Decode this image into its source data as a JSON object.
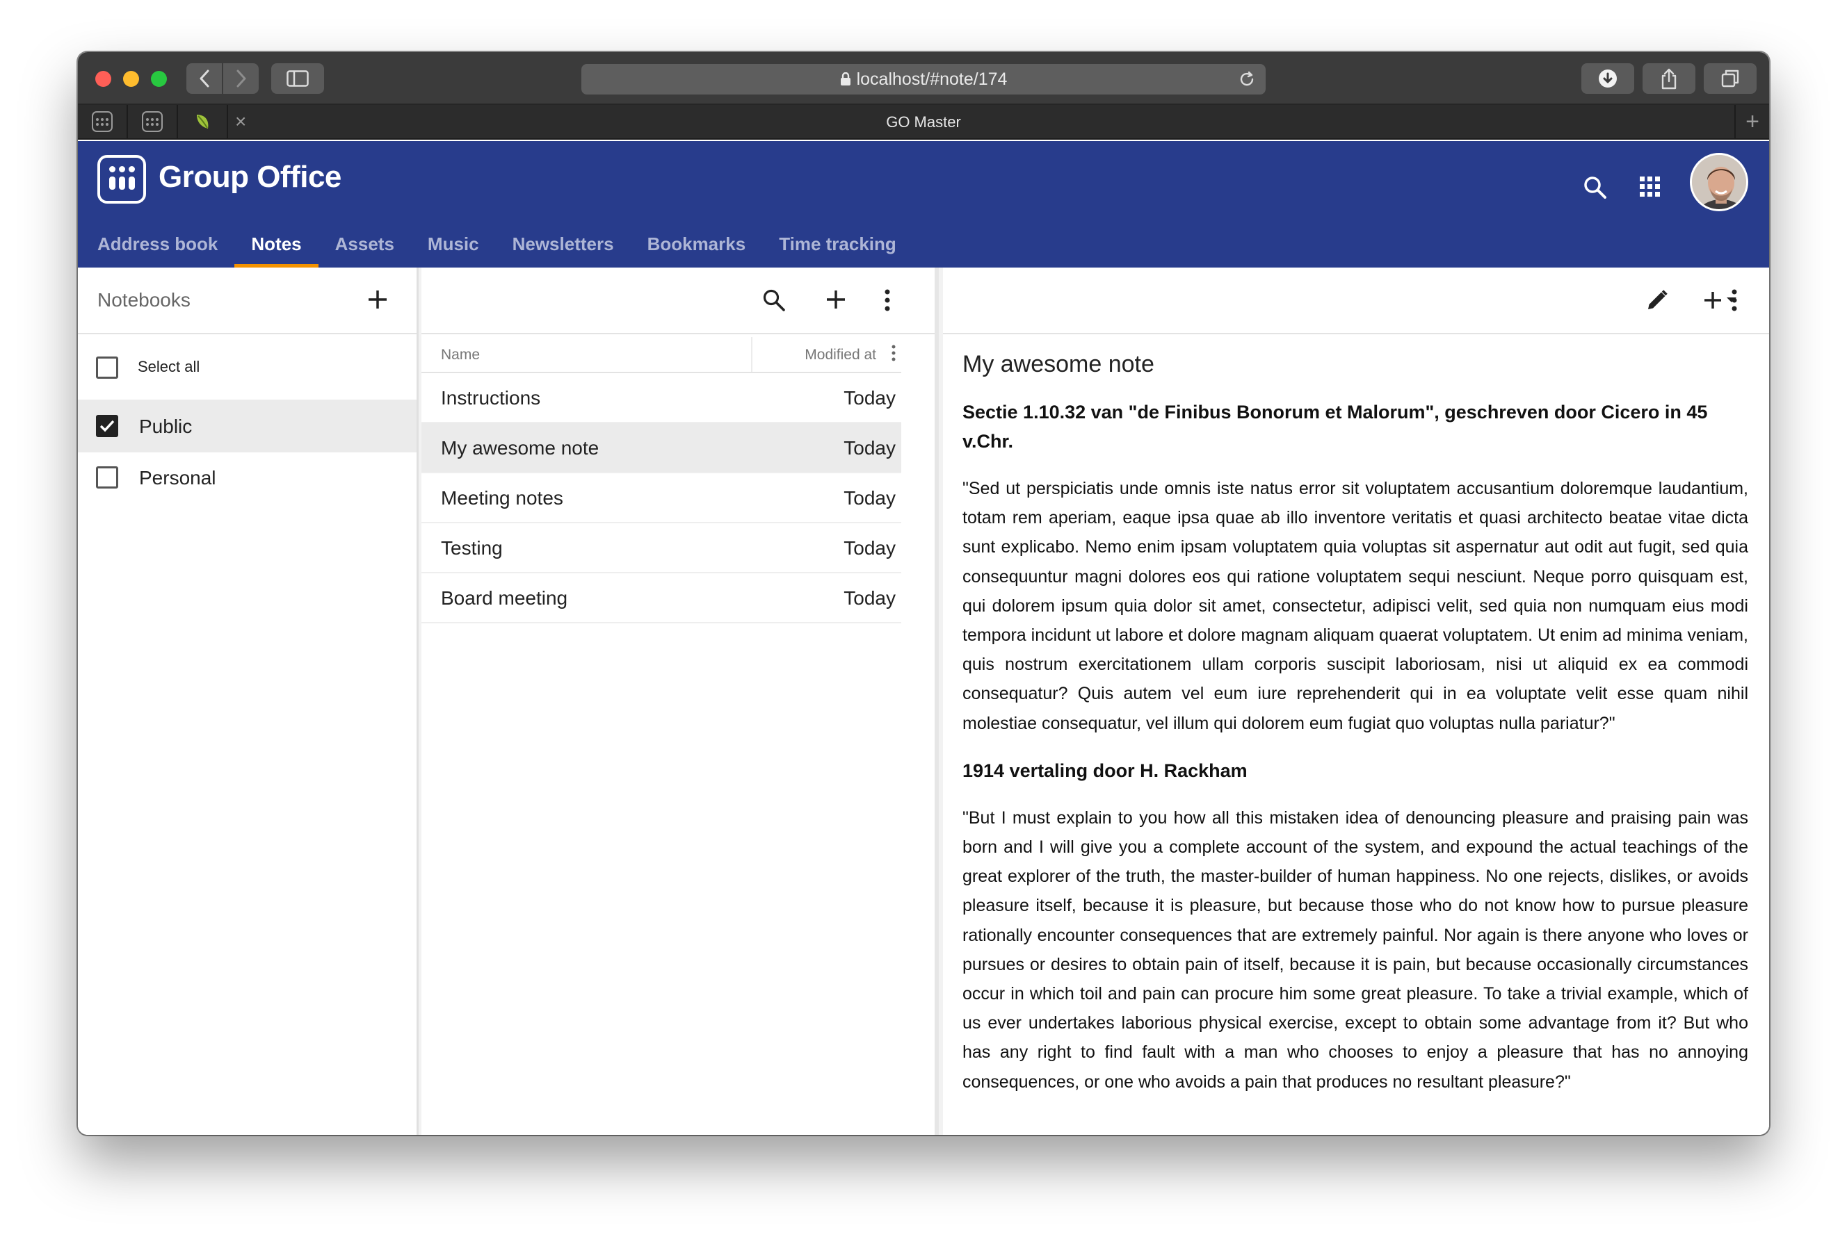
{
  "browser": {
    "url": "localhost/#note/174",
    "tab_title": "GO Master",
    "tab_close_glyph": "×",
    "new_tab_glyph": "+"
  },
  "app": {
    "title": "Group Office",
    "brand_color": "#283c8c",
    "accent_color": "#f39200",
    "modules": [
      {
        "label": "Address book"
      },
      {
        "label": "Notes",
        "active": true
      },
      {
        "label": "Assets"
      },
      {
        "label": "Music"
      },
      {
        "label": "Newsletters"
      },
      {
        "label": "Bookmarks"
      },
      {
        "label": "Time tracking"
      }
    ]
  },
  "sidebar": {
    "title": "Notebooks",
    "select_all": "Select all",
    "notebooks": [
      {
        "label": "Public",
        "checked": true
      },
      {
        "label": "Personal",
        "checked": false
      }
    ]
  },
  "note_list": {
    "columns": {
      "name": "Name",
      "modified": "Modified at"
    },
    "rows": [
      {
        "name": "Instructions",
        "modified": "Today"
      },
      {
        "name": "My awesome note",
        "modified": "Today",
        "selected": true
      },
      {
        "name": "Meeting notes",
        "modified": "Today"
      },
      {
        "name": "Testing",
        "modified": "Today"
      },
      {
        "name": "Board meeting",
        "modified": "Today"
      }
    ]
  },
  "note": {
    "title": "My awesome note",
    "heading_1": "Sectie 1.10.32 van \"de Finibus Bonorum et Malorum\", geschreven door Cicero in 45 v.Chr.",
    "paragraph_1": "\"Sed ut perspiciatis unde omnis iste natus error sit voluptatem accusantium doloremque laudantium, totam rem aperiam, eaque ipsa quae ab illo inventore veritatis et quasi architecto beatae vitae dicta sunt explicabo. Nemo enim ipsam voluptatem quia voluptas sit aspernatur aut odit aut fugit, sed quia consequuntur magni dolores eos qui ratione voluptatem sequi nesciunt. Neque porro quisquam est, qui dolorem ipsum quia dolor sit amet, consectetur, adipisci velit, sed quia non numquam eius modi tempora incidunt ut labore et dolore magnam aliquam quaerat voluptatem. Ut enim ad minima veniam, quis nostrum exercitationem ullam corporis suscipit laboriosam, nisi ut aliquid ex ea commodi consequatur? Quis autem vel eum iure reprehenderit qui in ea voluptate velit esse quam nihil molestiae consequatur, vel illum qui dolorem eum fugiat quo voluptas nulla pariatur?\"",
    "heading_2": "1914 vertaling door H. Rackham",
    "paragraph_2": "\"But I must explain to you how all this mistaken idea of denouncing pleasure and praising pain was born and I will give you a complete account of the system, and expound the actual teachings of the great explorer of the truth, the master-builder of human happiness. No one rejects, dislikes, or avoids pleasure itself, because it is pleasure, but because those who do not know how to pursue pleasure rationally encounter consequences that are extremely painful. Nor again is there anyone who loves or pursues or desires to obtain pain of itself, because it is pain, but because occasionally circumstances occur in which toil and pain can procure him some great pleasure. To take a trivial example, which of us ever undertakes laborious physical exercise, except to obtain some advantage from it? But who has any right to find fault with a man who chooses to enjoy a pleasure that has no annoying consequences, or one who avoids a pain that produces no resultant pleasure?\""
  }
}
